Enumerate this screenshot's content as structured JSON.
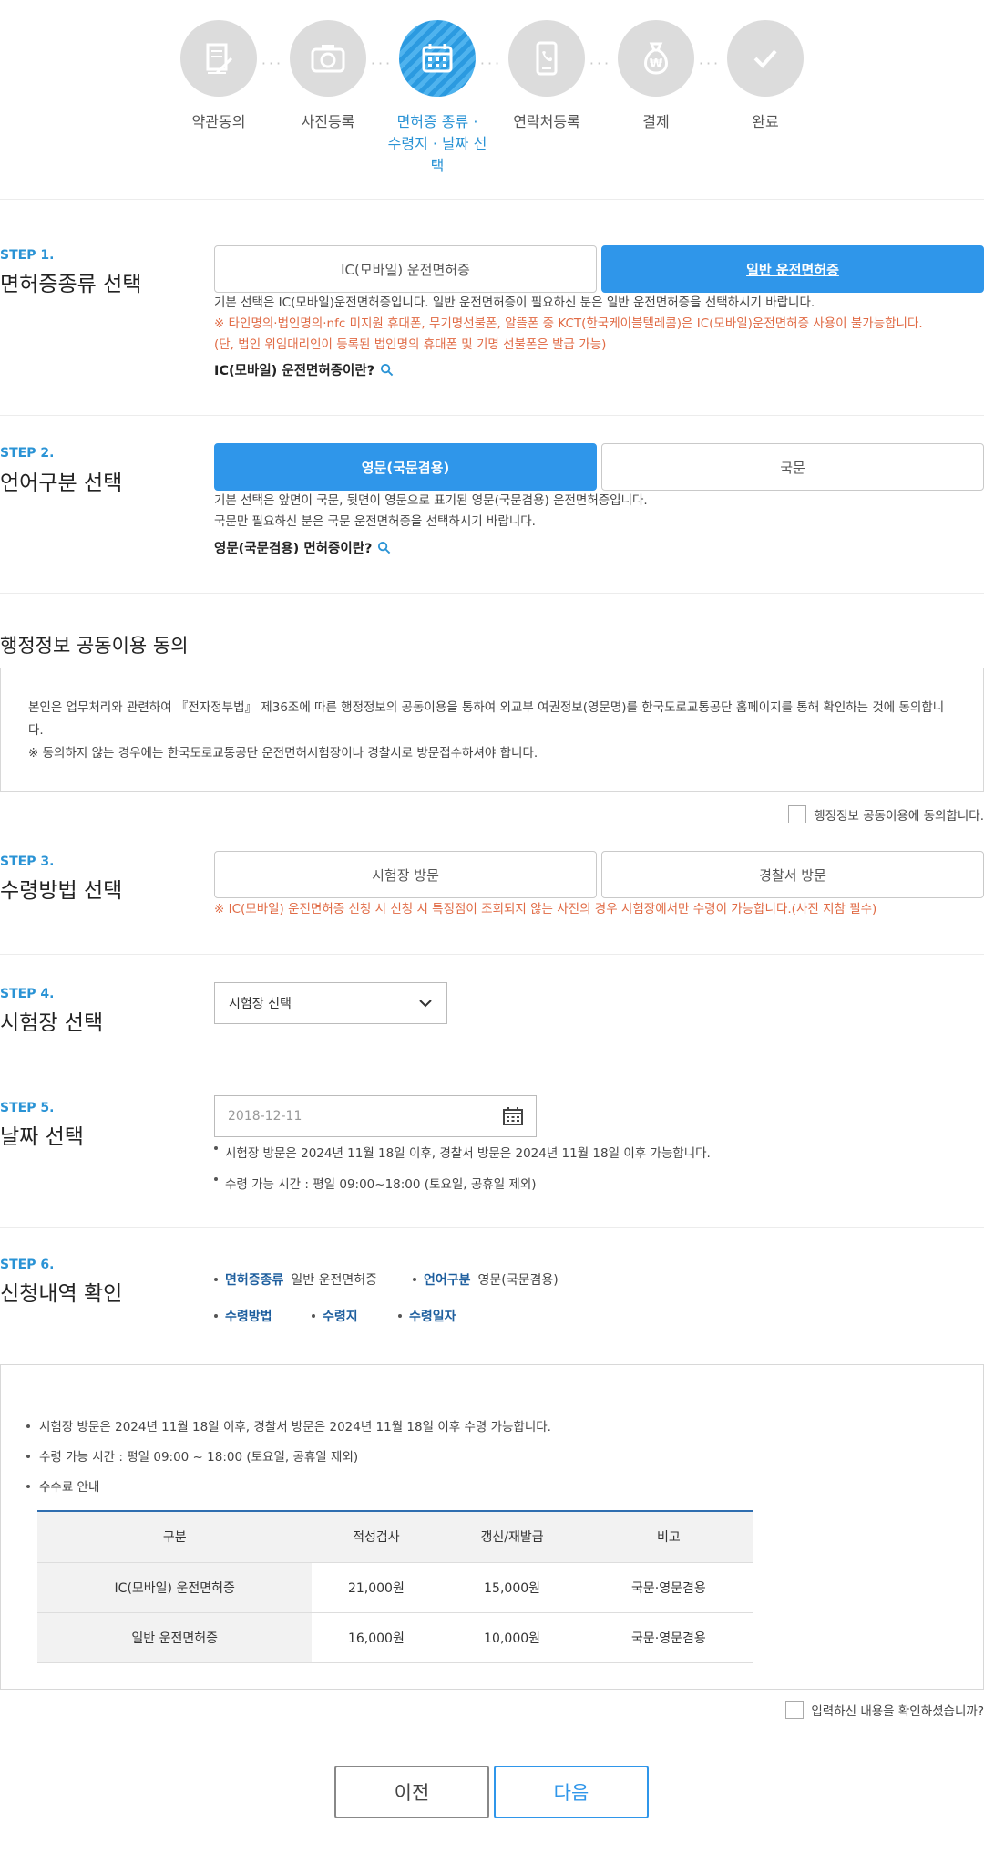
{
  "progress": {
    "steps": [
      {
        "label": "약관동의",
        "icon": "document-pen-icon"
      },
      {
        "label": "사진등록",
        "icon": "camera-icon"
      },
      {
        "label_line1": "면허증 종류 ·",
        "label_line2": "수령지 · 날짜 선택",
        "icon": "calendar-icon"
      },
      {
        "label": "연락처등록",
        "icon": "phone-icon"
      },
      {
        "label": "결제",
        "icon": "won-bag-icon"
      },
      {
        "label": "완료",
        "icon": "check-icon"
      }
    ],
    "dots": "···"
  },
  "step1": {
    "no": "STEP 1.",
    "title": "면허증종류 선택",
    "option_ic": "IC(모바일) 운전면허증",
    "option_general": "일반 운전면허증",
    "selected": "option_general",
    "desc1": "기본 선택은 IC(모바일)운전면허증입니다. 일반 운전면허증이 필요하신 분은 일반 운전면허증을 선택하시기 바랍니다.",
    "warn1": "※ 타인명의·법인명의·nfc 미지원 휴대폰, 무기명선불폰, 알뜰폰 중 KCT(한국케이블텔레콤)은 IC(모바일)운전면허증 사용이 불가능합니다.",
    "warn2": "(단, 법인 위임대리인이 등록된 법인명의 휴대폰 및 기명 선불폰은 발급 가능)",
    "help": "IC(모바일) 운전면허증이란?"
  },
  "step2": {
    "no": "STEP 2.",
    "title": "언어구분 선택",
    "option_en": "영문(국문겸용)",
    "option_ko": "국문",
    "selected": "option_en",
    "desc1": "기본 선택은 앞면이 국문, 뒷면이 영문으로 표기된 영문(국문겸용) 운전면허증입니다.",
    "desc2": "국문만 필요하신 분은 국문 운전면허증을 선택하시기 바랍니다.",
    "help": "영문(국문겸용) 면허증이란?"
  },
  "agreement": {
    "title": "행정정보 공동이용 동의",
    "text1": "본인은 업무처리와 관련하여 『전자정부법』 제36조에 따른 행정정보의 공동이용을 통하여 외교부 여권정보(영문명)를 한국도로교통공단 홈페이지를 통해 확인하는 것에 동의합니다.",
    "text2": "※ 동의하지 않는 경우에는 한국도로교통공단 운전면허시험장이나 경찰서로 방문접수하셔야 합니다.",
    "checkbox_label": "행정정보 공동이용에 동의합니다."
  },
  "step3": {
    "no": "STEP 3.",
    "title": "수령방법 선택",
    "option_exam": "시험장 방문",
    "option_police": "경찰서 방문",
    "warn": "※ IC(모바일) 운전면허증 신청 시 신청 시 특징점이 조회되지 않는 사진의 경우 시험장에서만 수령이 가능합니다.(사진 지참 필수)"
  },
  "step4": {
    "no": "STEP 4.",
    "title": "시험장 선택",
    "select_value": "시험장 선택"
  },
  "step5": {
    "no": "STEP 5.",
    "title": "날짜 선택",
    "date_placeholder": "2018-12-11",
    "note1": "시험장 방문은 2024년 11월 18일 이후, 경찰서 방문은 2024년 11월 18일 이후 가능합니다.",
    "note2": "수령 가능 시간 : 평일 09:00~18:00 (토요일, 공휴일 제외)"
  },
  "step6": {
    "no": "STEP 6.",
    "title": "신청내역 확인",
    "license_type_label": "면허증종류",
    "license_type_value": "일반 운전면허증",
    "language_label": "언어구분",
    "language_value": "영문(국문겸용)",
    "method_label": "수령방법",
    "place_label": "수령지",
    "date_label": "수령일자"
  },
  "fee_info": {
    "note1": "시험장 방문은 2024년 11월 18일 이후, 경찰서 방문은 2024년 11월 18일 이후 수령 가능합니다.",
    "note2": "수령 가능 시간 : 평일 09:00 ~ 18:00 (토요일, 공휴일 제외)",
    "note3": "수수료 안내",
    "table": {
      "headers": [
        "구분",
        "적성검사",
        "갱신/재발급",
        "비고"
      ],
      "rows": [
        [
          "IC(모바일) 운전면허증",
          "21,000원",
          "15,000원",
          "국문·영문겸용"
        ],
        [
          "일반 운전면허증",
          "16,000원",
          "10,000원",
          "국문·영문겸용"
        ]
      ]
    }
  },
  "confirm": {
    "checkbox_label": "입력하신 내용을 확인하셨습니까?"
  },
  "nav": {
    "prev": "이전",
    "next": "다음"
  },
  "colors": {
    "accent": "#2f96ea",
    "step_label": "#2a93d5",
    "warning": "#e06a44",
    "inactive_circle": "#dcdcdc"
  }
}
